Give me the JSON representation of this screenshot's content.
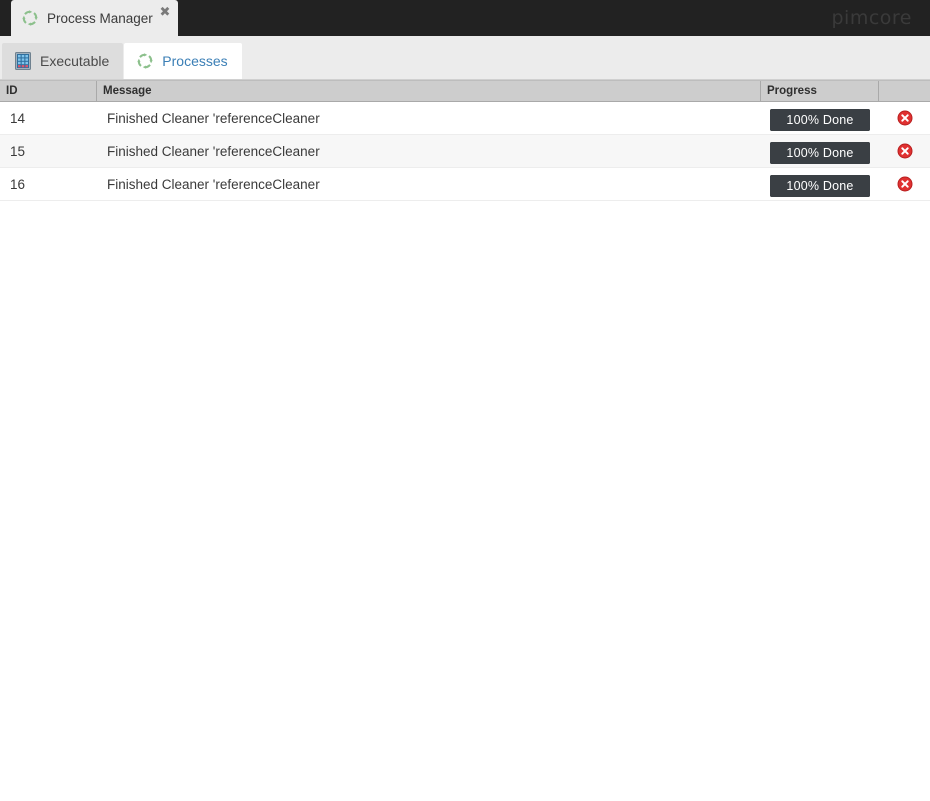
{
  "window": {
    "tab_title": "Process Manager",
    "tab_icon": "processes-refresh-icon",
    "close_label": "✖",
    "brand": "pimcore",
    "brand_color": "#3a3a3a",
    "bar_color": "#222222"
  },
  "tabs": [
    {
      "label": "Executable",
      "icon": "executable-grid-icon",
      "active": false
    },
    {
      "label": "Processes",
      "icon": "processes-refresh-icon",
      "active": true
    }
  ],
  "grid": {
    "columns": [
      {
        "key": "id",
        "header": "ID"
      },
      {
        "key": "message",
        "header": "Message"
      },
      {
        "key": "progress",
        "header": "Progress"
      },
      {
        "key": "action",
        "header": ""
      }
    ],
    "rows": [
      {
        "id": "14",
        "message": "Finished Cleaner 'referenceCleaner",
        "progress_label": "100% Done",
        "progress_percent": 100,
        "action_icon": "delete-icon"
      },
      {
        "id": "15",
        "message": "Finished Cleaner 'referenceCleaner",
        "progress_label": "100% Done",
        "progress_percent": 100,
        "action_icon": "delete-icon"
      },
      {
        "id": "16",
        "message": "Finished Cleaner 'referenceCleaner",
        "progress_label": "100% Done",
        "progress_percent": 100,
        "action_icon": "delete-icon"
      }
    ],
    "colors": {
      "header_bg": "#cdcdcd",
      "row_alt_bg": "#f7f7f7",
      "progress_bar": "#3a3f44",
      "progress_text": "#ffffff",
      "delete_icon": "#e03131"
    }
  }
}
